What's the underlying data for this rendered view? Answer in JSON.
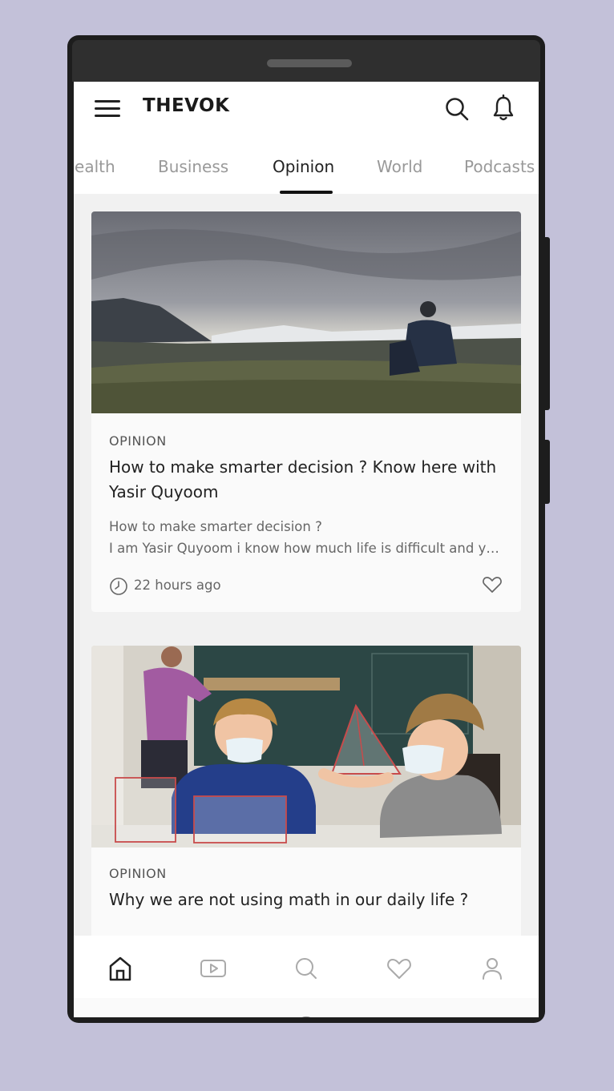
{
  "app": {
    "logo": "THEVOK"
  },
  "tabs": [
    {
      "label": "Health",
      "active": false
    },
    {
      "label": "Business",
      "active": false
    },
    {
      "label": "Opinion",
      "active": true
    },
    {
      "label": "World",
      "active": false
    },
    {
      "label": "Podcasts",
      "active": false
    }
  ],
  "articles": [
    {
      "category": "OPINION",
      "title": "How to make smarter decision ? Know here with Yasir Quyoom",
      "excerpt_line1": "How to make smarter decision ?",
      "excerpt_line2": "I am Yasir Quyoom i know how much life is difficult and you must know how to make smarter decisions",
      "time": "22 hours ago"
    },
    {
      "category": "OPINION",
      "title": "Why we are not using math in our daily life ?"
    }
  ],
  "bottom_nav": [
    "home-icon",
    "video-icon",
    "search-icon",
    "heart-icon",
    "profile-icon"
  ],
  "colors": {
    "background": "#c3c1d9",
    "text": "#222222",
    "muted": "#999999",
    "accent": "#111111"
  }
}
